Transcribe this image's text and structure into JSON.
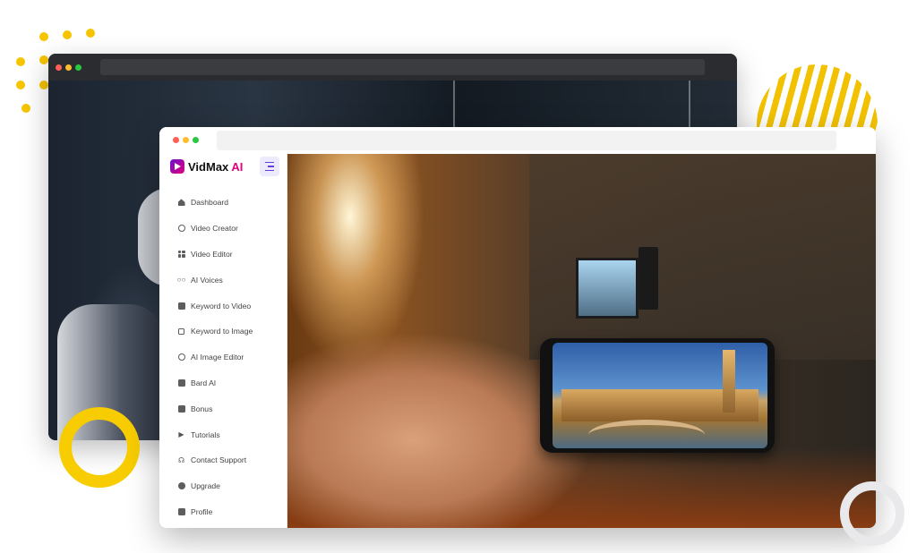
{
  "app": {
    "brand_name": "VidMax",
    "brand_suffix": "AI"
  },
  "sidebar": {
    "items": [
      {
        "label": "Dashboard",
        "icon": "home-icon"
      },
      {
        "label": "Video Creator",
        "icon": "globe-icon"
      },
      {
        "label": "Video Editor",
        "icon": "grid-icon"
      },
      {
        "label": "AI Voices",
        "icon": "voicemail-icon"
      },
      {
        "label": "Keyword to Video",
        "icon": "chat-icon"
      },
      {
        "label": "Keyword to Image",
        "icon": "image-icon"
      },
      {
        "label": "AI Image Editor",
        "icon": "broadcast-icon"
      },
      {
        "label": "Bard AI",
        "icon": "document-icon"
      },
      {
        "label": "Bonus",
        "icon": "gift-icon"
      },
      {
        "label": "Tutorials",
        "icon": "play-icon"
      },
      {
        "label": "Contact Support",
        "icon": "headphones-icon"
      },
      {
        "label": "Upgrade",
        "icon": "upload-icon"
      },
      {
        "label": "Profile",
        "icon": "profile-icon"
      }
    ]
  },
  "colors": {
    "accent": "#e0007a",
    "brand_gradient_start": "#6a11cb",
    "toggle_bg": "#eceafd",
    "decoration_yellow": "#f6c400"
  }
}
